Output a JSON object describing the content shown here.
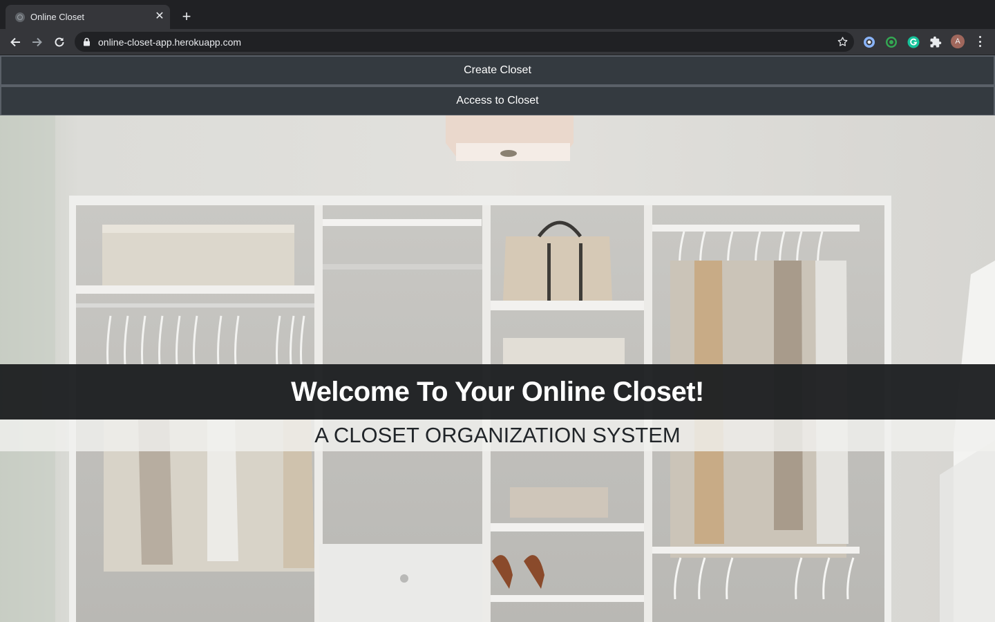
{
  "browser": {
    "tab_title": "Online Closet",
    "url": "online-closet-app.herokuapp.com",
    "avatar_letter": "A"
  },
  "nav": {
    "create_label": "Create Closet",
    "access_label": "Access to Closet"
  },
  "hero": {
    "heading": "Welcome To Your Online Closet!",
    "subheading": "A CLOSET ORGANIZATION SYSTEM",
    "image": "closet-photo"
  },
  "colors": {
    "navbar_bg": "#343a40",
    "heading_band_bg": "#1f2123",
    "subheading_band_bg": "#f0f0ee"
  }
}
